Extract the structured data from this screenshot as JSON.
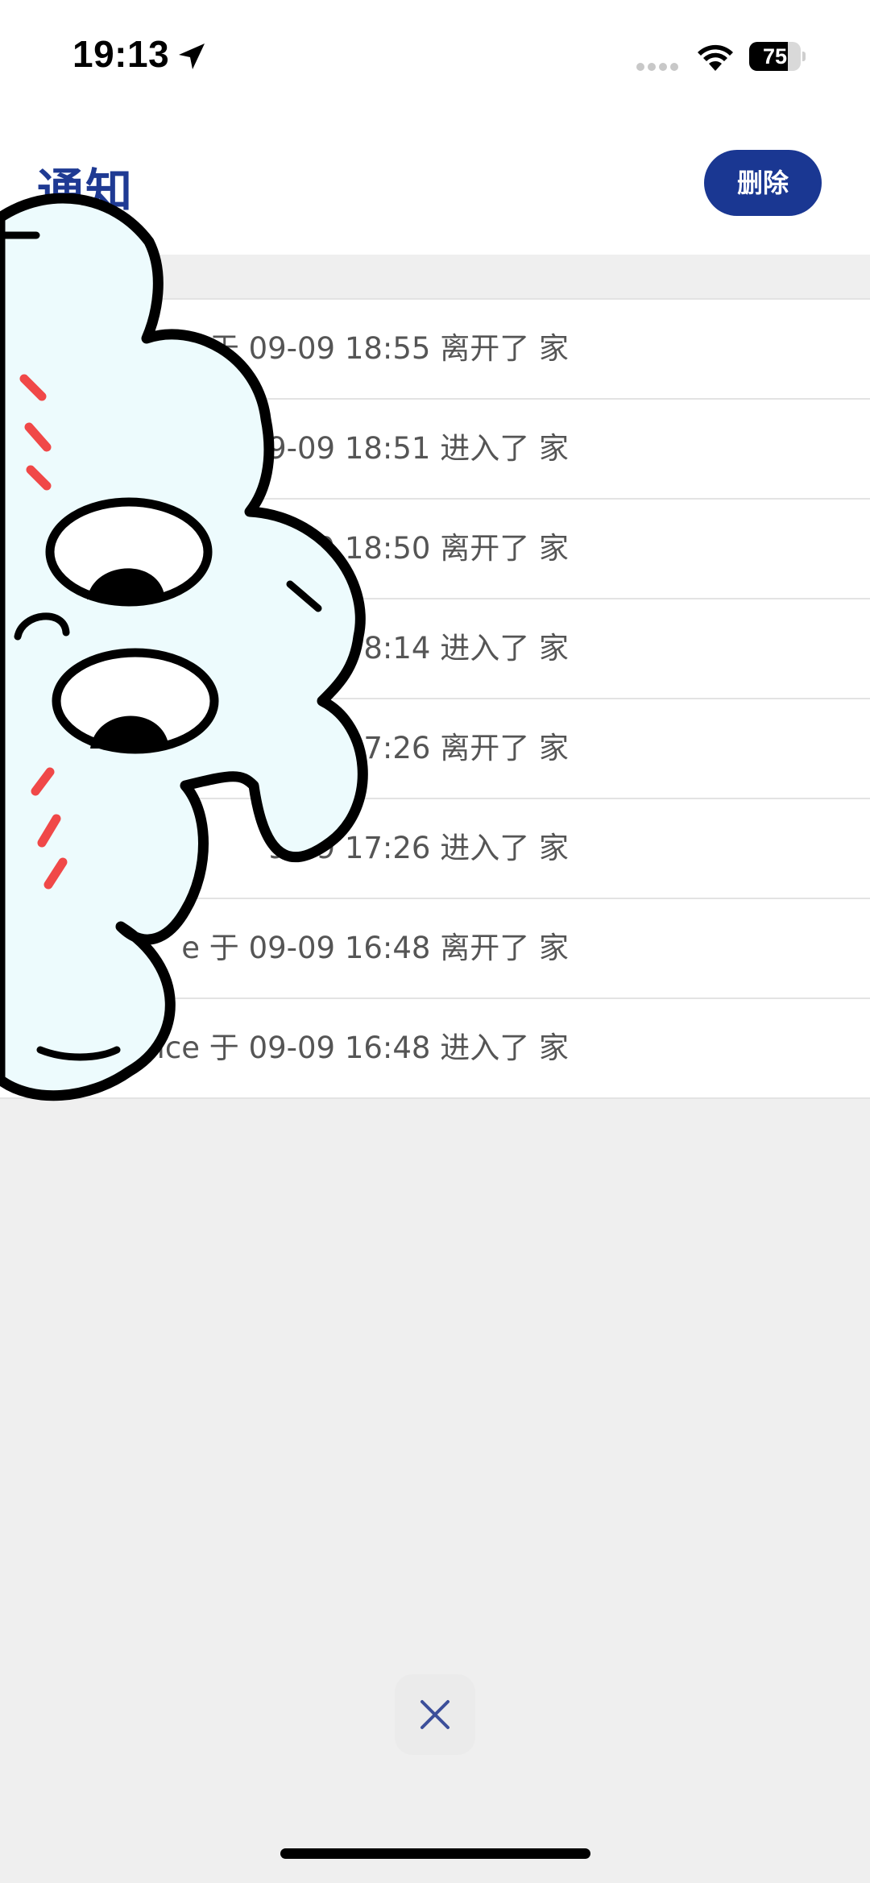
{
  "status_bar": {
    "time": "19:13",
    "battery": "75",
    "battery_level": 0.75,
    "icons": [
      "location-arrow-icon",
      "cellular-signal-icon",
      "wifi-icon",
      "battery-icon"
    ]
  },
  "header": {
    "title": "通知",
    "delete_label": "删除",
    "accent_color": "#1a3792"
  },
  "notifications": [
    {
      "text": "于 09-09 18:55 离开了 家"
    },
    {
      "text": "9-09 18:51 进入了 家"
    },
    {
      "text": "09 18:50 离开了 家"
    },
    {
      "text": "8:14 进入了 家"
    },
    {
      "text": "9 17:26 离开了 家"
    },
    {
      "text": "9-09 17:26 进入了 家"
    },
    {
      "text": "e 于 09-09 16:48 离开了 家"
    },
    {
      "text": "ice 于 09-09 16:48 进入了 家"
    }
  ],
  "overlay": {
    "icon": "cloud-mascot-sticker"
  },
  "footer": {
    "close_icon": "close-icon"
  }
}
